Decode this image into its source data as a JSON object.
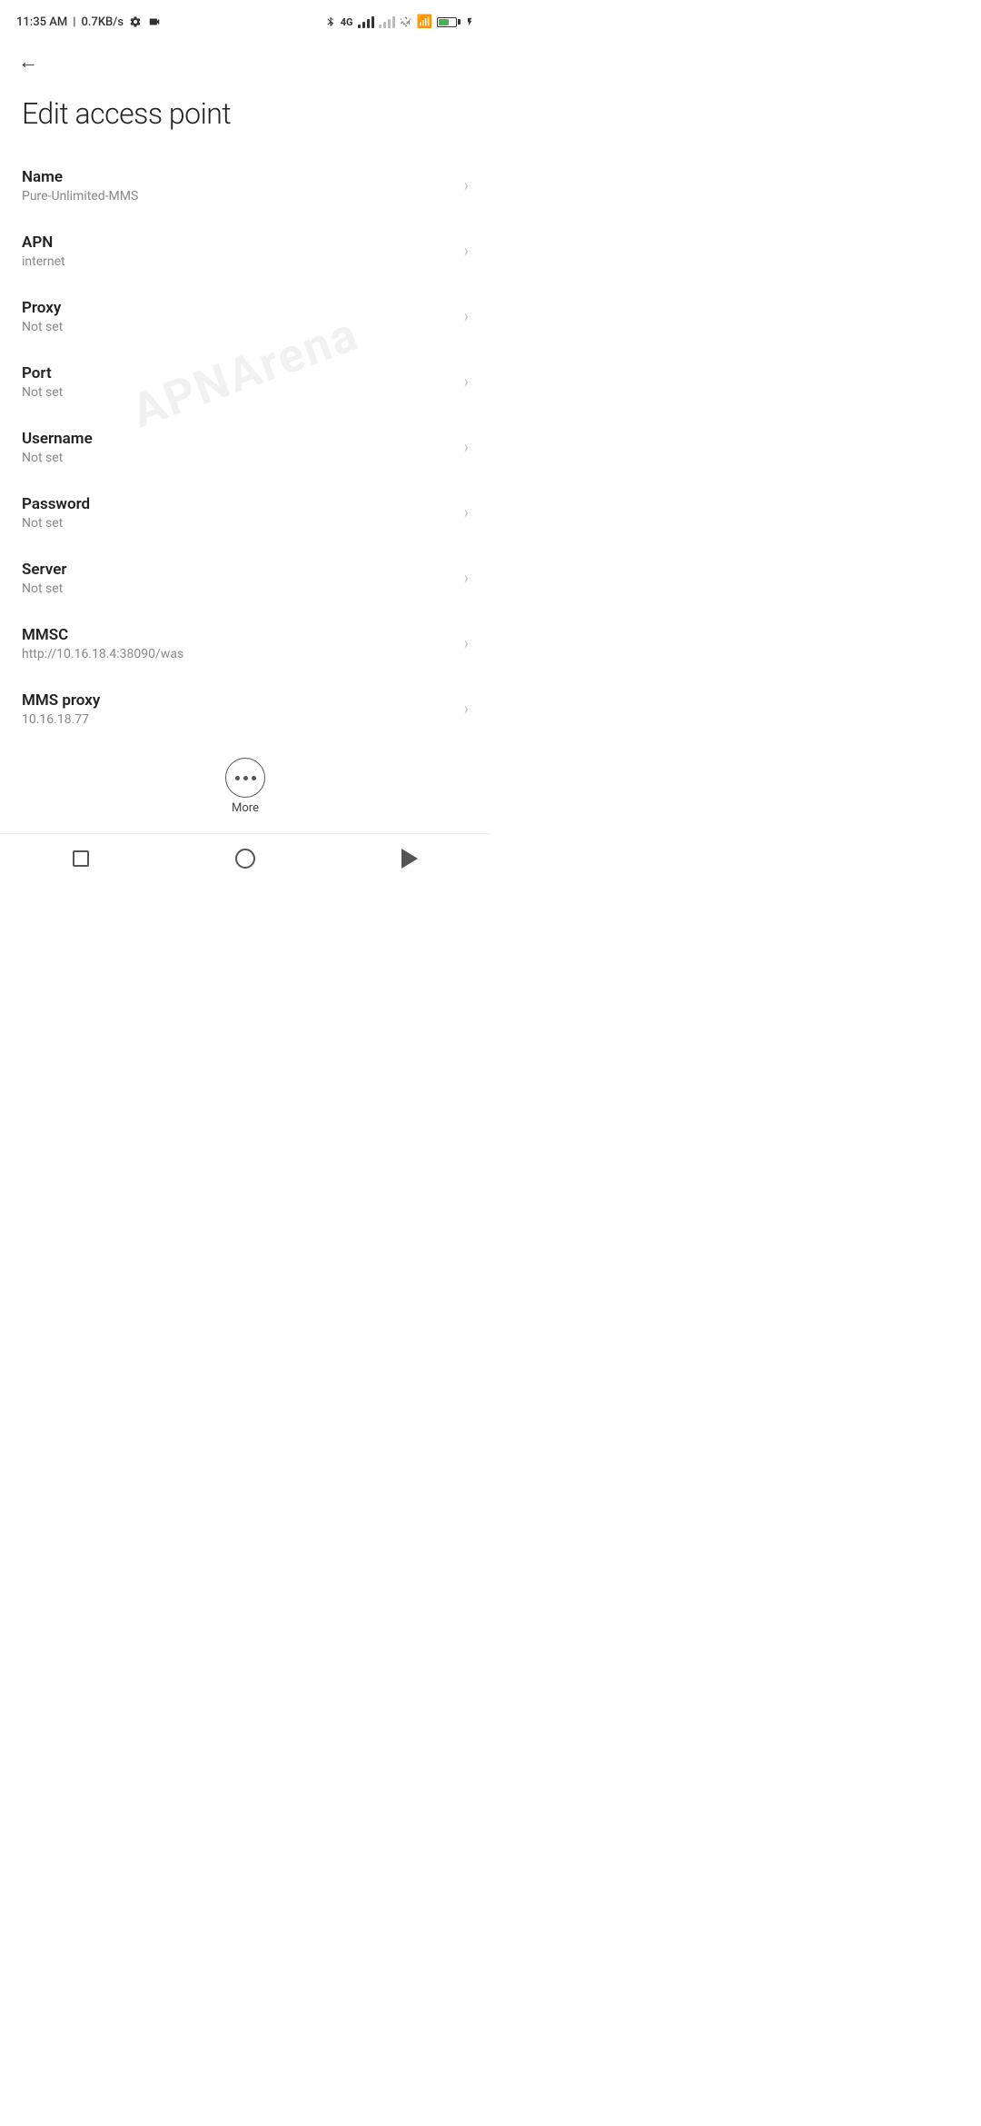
{
  "statusBar": {
    "time": "11:35 AM",
    "speed": "0.7KB/s",
    "batteryPercent": "38"
  },
  "topNav": {
    "backLabel": "←"
  },
  "pageTitle": "Edit access point",
  "settings": [
    {
      "label": "Name",
      "value": "Pure-Unlimited-MMS"
    },
    {
      "label": "APN",
      "value": "internet"
    },
    {
      "label": "Proxy",
      "value": "Not set"
    },
    {
      "label": "Port",
      "value": "Not set"
    },
    {
      "label": "Username",
      "value": "Not set"
    },
    {
      "label": "Password",
      "value": "Not set"
    },
    {
      "label": "Server",
      "value": "Not set"
    },
    {
      "label": "MMSC",
      "value": "http://10.16.18.4:38090/was"
    },
    {
      "label": "MMS proxy",
      "value": "10.16.18.77"
    }
  ],
  "more": {
    "label": "More"
  },
  "watermark": "APNArena"
}
